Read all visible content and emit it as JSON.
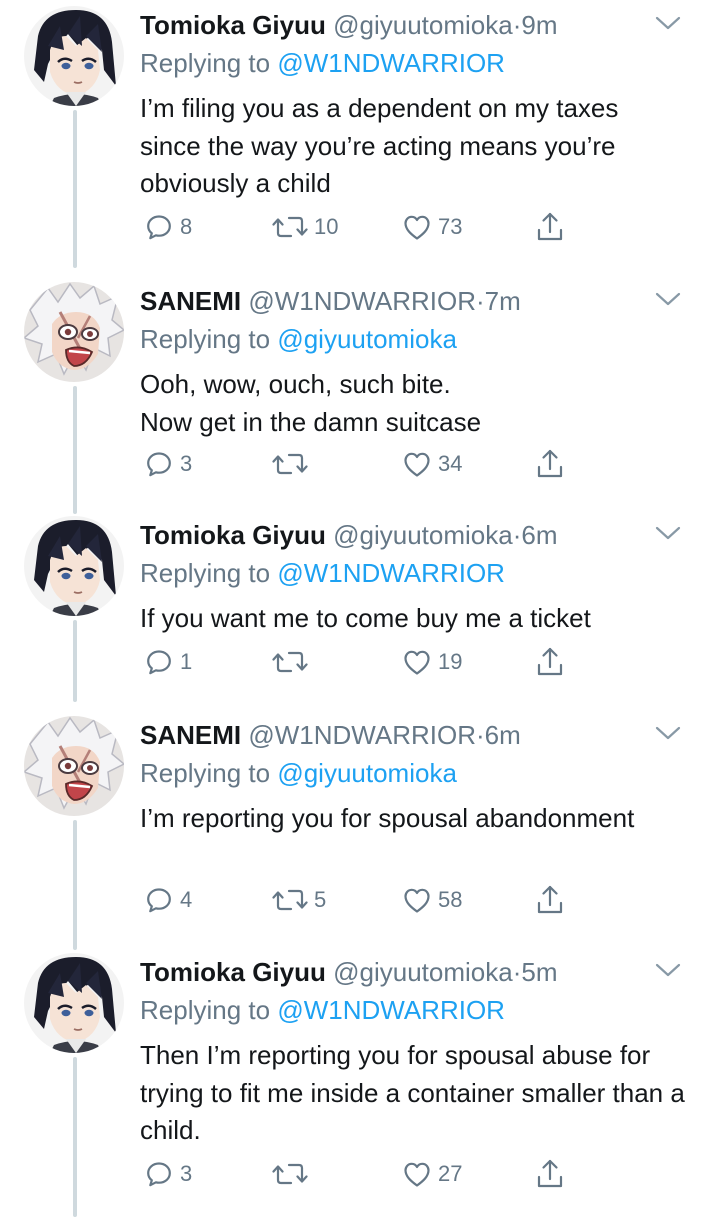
{
  "tweets": [
    {
      "name": "Tomioka Giyuu",
      "handle": "@giyuutomioka",
      "time": "9m",
      "replying_prefix": "Replying to ",
      "replying_to": "@W1NDWARRIOR",
      "text": "I’m filing you as a dependent on my taxes since the way you’re acting means you’re obviously a child",
      "replies": "8",
      "retweets": "10",
      "likes": "73",
      "avatar": "giyuu-avatar"
    },
    {
      "name": "SANEMI",
      "handle": "@W1NDWARRIOR",
      "time": "7m",
      "replying_prefix": "Replying to ",
      "replying_to": "@giyuutomioka",
      "text": "Ooh, wow, ouch, such bite.\nNow get in the damn suitcase",
      "replies": "3",
      "retweets": "",
      "likes": "34",
      "avatar": "sanemi-avatar"
    },
    {
      "name": "Tomioka Giyuu",
      "handle": "@giyuutomioka",
      "time": "6m",
      "replying_prefix": "Replying to ",
      "replying_to": "@W1NDWARRIOR",
      "text": "If you want me to come buy me a ticket",
      "replies": "1",
      "retweets": "",
      "likes": "19",
      "avatar": "giyuu-avatar"
    },
    {
      "name": "SANEMI",
      "handle": "@W1NDWARRIOR",
      "time": "6m",
      "replying_prefix": "Replying to ",
      "replying_to": "@giyuutomioka",
      "text": "I’m reporting you for spousal abandonment",
      "replies": "4",
      "retweets": "5",
      "likes": "58",
      "avatar": "sanemi-avatar"
    },
    {
      "name": "Tomioka Giyuu",
      "handle": "@giyuutomioka",
      "time": "5m",
      "replying_prefix": "Replying to ",
      "replying_to": "@W1NDWARRIOR",
      "text": "Then I’m reporting you for spousal abuse for trying to fit me inside a container smaller than a child.",
      "replies": "3",
      "retweets": "",
      "likes": "27",
      "avatar": "giyuu-avatar"
    }
  ],
  "separator": "·",
  "colors": {
    "text": "#14171a",
    "secondary": "#657786",
    "link": "#1da1f2",
    "thread_line": "#cfd9de",
    "background": "#ffffff"
  },
  "icons": [
    "reply-icon",
    "retweet-icon",
    "like-icon",
    "share-icon",
    "chevron-down-icon"
  ]
}
